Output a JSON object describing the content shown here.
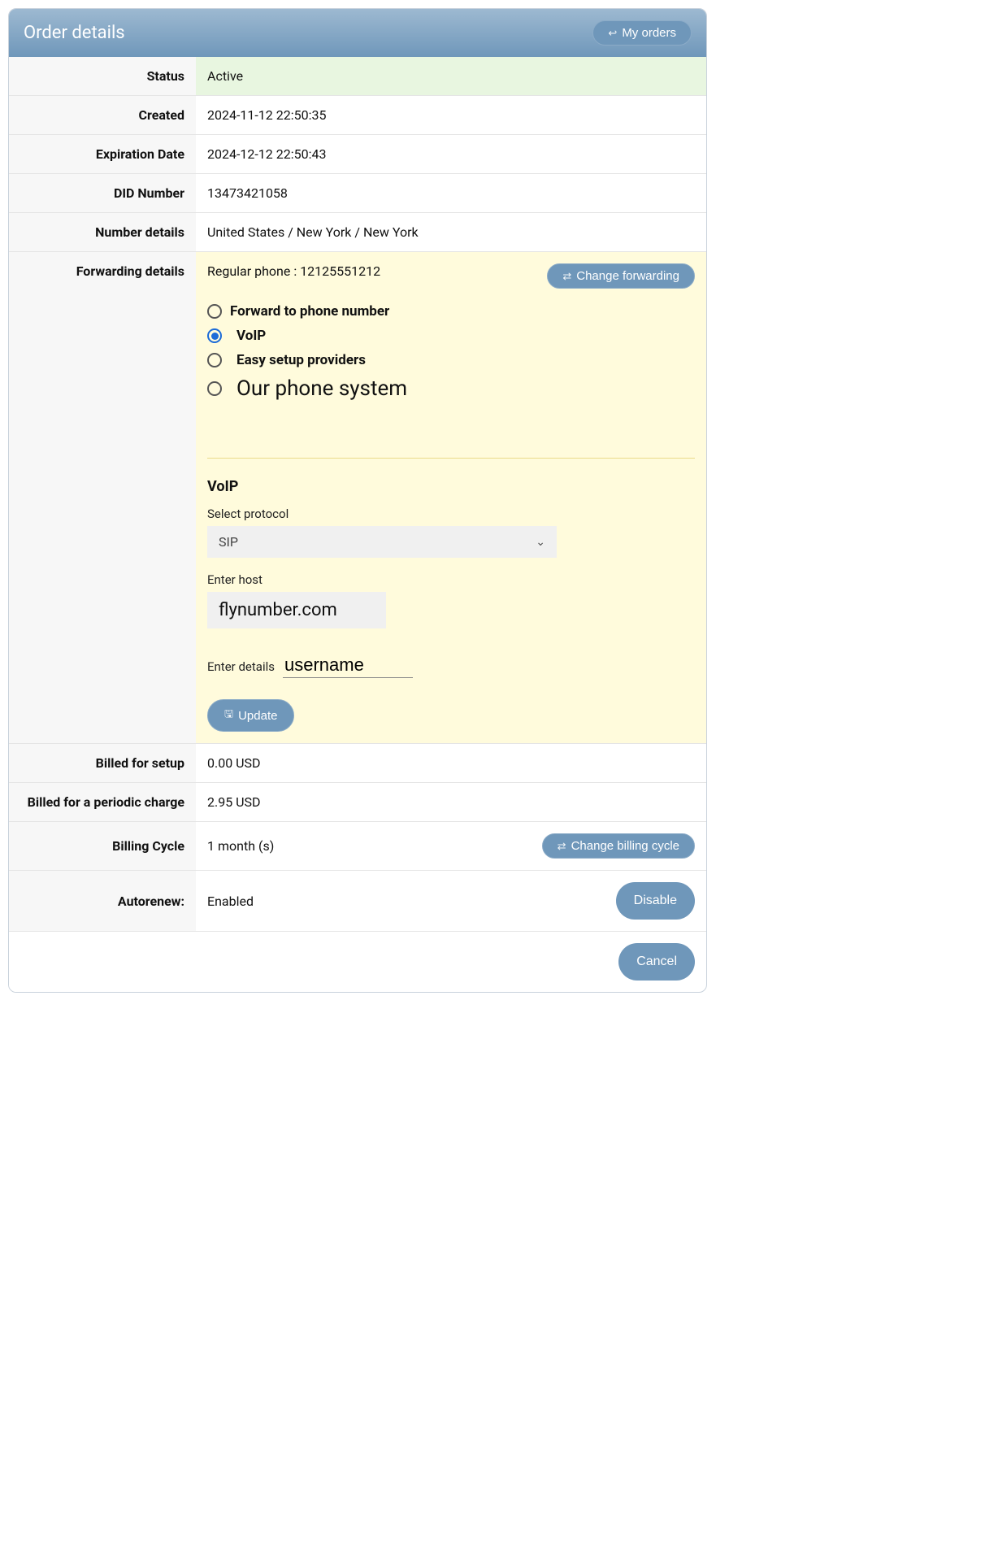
{
  "header": {
    "title": "Order details",
    "my_orders_label": "My orders"
  },
  "rows": {
    "status": {
      "label": "Status",
      "value": "Active"
    },
    "created": {
      "label": "Created",
      "value": "2024-11-12 22:50:35"
    },
    "expiration": {
      "label": "Expiration Date",
      "value": "2024-12-12 22:50:43"
    },
    "did": {
      "label": "DID Number",
      "value": "13473421058"
    },
    "numdetails": {
      "label": "Number details",
      "value": "United States / New York / New York"
    },
    "forwarding": {
      "label": "Forwarding details",
      "summary": "Regular phone  : 12125551212",
      "change_btn": "Change forwarding",
      "options": {
        "phone": "Forward to phone number",
        "voip": "VoIP",
        "easy": "Easy setup providers",
        "ours": "Our phone system"
      },
      "voip_heading": "VoIP",
      "protocol_label": "Select protocol",
      "protocol_value": "SIP",
      "host_label": "Enter host",
      "host_value": "flynumber.com",
      "details_label": "Enter details",
      "details_value": "username",
      "update_btn": "Update"
    },
    "billed_setup": {
      "label": "Billed for setup",
      "value": "0.00 USD"
    },
    "billed_periodic": {
      "label": "Billed for a periodic charge",
      "value": "2.95 USD"
    },
    "billing_cycle": {
      "label": "Billing Cycle",
      "value": "1 month (s)",
      "btn": "Change billing cycle"
    },
    "autorenew": {
      "label": "Autorenew:",
      "value": "Enabled",
      "btn": "Disable"
    }
  },
  "footer": {
    "cancel": "Cancel"
  }
}
